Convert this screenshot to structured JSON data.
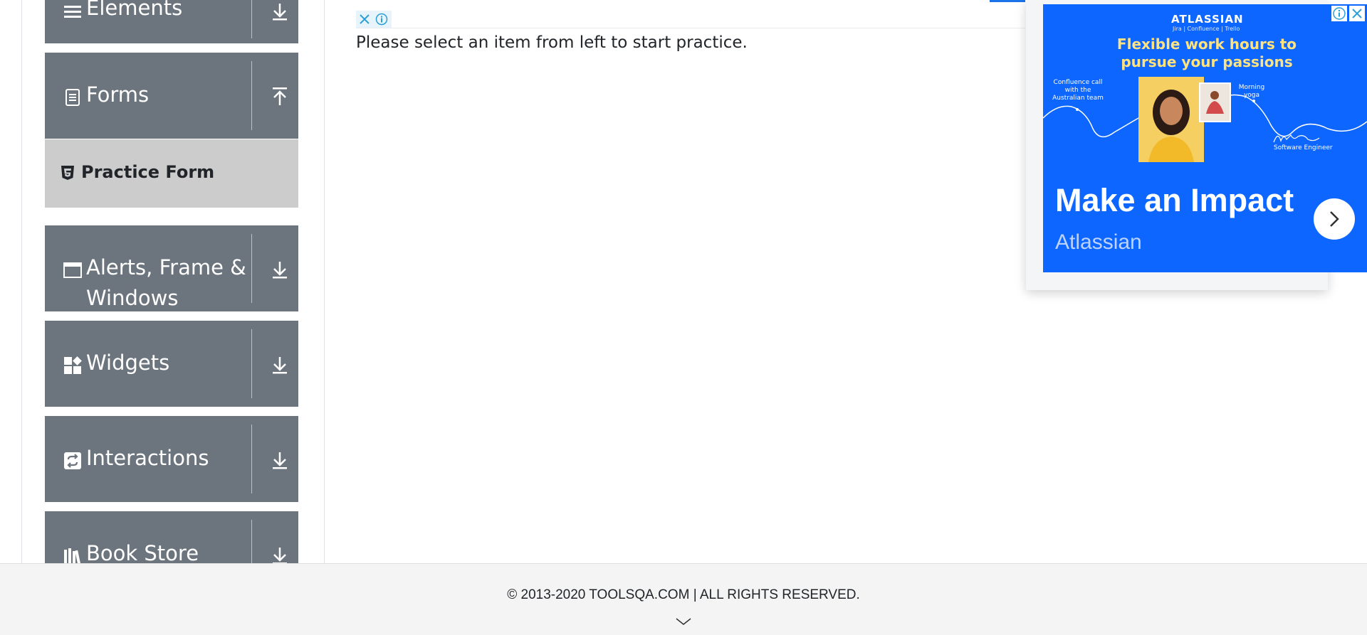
{
  "sidebar": {
    "groups": [
      {
        "label": "Elements",
        "icon": "hamburger-icon",
        "toggle": "arrow-down"
      },
      {
        "label": "Forms",
        "icon": "document-icon",
        "toggle": "arrow-up"
      },
      {
        "label": "Alerts, Frame &",
        "label_line2": "Windows",
        "icon": "window-icon",
        "toggle": "arrow-down"
      },
      {
        "label": "Widgets",
        "icon": "widgets-icon",
        "toggle": "arrow-down"
      },
      {
        "label": "Interactions",
        "icon": "interactions-icon",
        "toggle": "arrow-down"
      },
      {
        "label": "Book Store",
        "icon": "books-icon",
        "toggle": "arrow-down"
      }
    ],
    "active_item": {
      "label": "Practice Form",
      "icon": "html5-icon"
    }
  },
  "main": {
    "message": "Please select an item from left to start practice."
  },
  "ad": {
    "brand": "ATLASSIAN",
    "products": "Jira | Confluence | Trello",
    "headline": "Flexible work hours to pursue your passions",
    "note_left": "Confluence call with the Australian team",
    "note_right": "Morning yoga",
    "role": "Software Engineer",
    "title": "Make an Impact",
    "advertiser": "Atlassian"
  },
  "footer": {
    "copyright": "© 2013-2020 TOOLSQA.COM | ALL RIGHTS RESERVED."
  },
  "colors": {
    "sidebar_bg": "#6c757d",
    "active_item_bg": "#cccccc",
    "ad_bg": "#0d66ff",
    "ad_headline": "#ffe380",
    "footer_bg": "#f4f4f4"
  }
}
